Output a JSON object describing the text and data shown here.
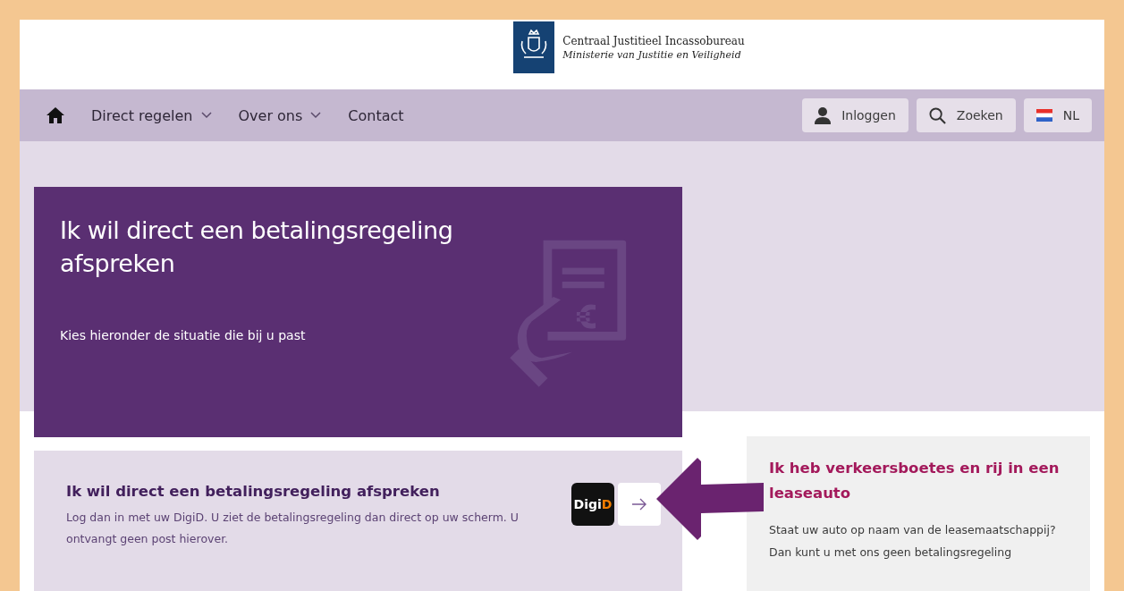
{
  "header": {
    "org_name": "Centraal Justitieel Incassobureau",
    "ministry": "Ministerie van Justitie en Veiligheid"
  },
  "nav": {
    "items": [
      {
        "label": "Direct regelen",
        "has_dropdown": true
      },
      {
        "label": "Over ons",
        "has_dropdown": true
      },
      {
        "label": "Contact",
        "has_dropdown": false
      }
    ],
    "buttons": [
      {
        "kind": "login",
        "label": "Inloggen"
      },
      {
        "kind": "search",
        "label": "Zoeken"
      },
      {
        "kind": "language",
        "label": "NL"
      }
    ]
  },
  "hero": {
    "title": "Ik wil direct een betalingsregeling afspreken",
    "subtitle": "Kies hieronder de situatie die bij u past"
  },
  "option_card": {
    "title": "Ik wil direct een betalingsregeling afspreken",
    "body": "Log dan in met uw DigiD. U ziet de betalingsregeling dan direct op uw scherm. U ontvangt geen post hierover.",
    "digid_logo": {
      "main": "Digi",
      "accent": "D"
    }
  },
  "side_card": {
    "title": "Ik heb verkeersboetes en rij in een leaseauto",
    "body": "Staat uw auto op naam van de leasemaatschappij? Dan kunt u met ons geen betalingsregeling"
  }
}
